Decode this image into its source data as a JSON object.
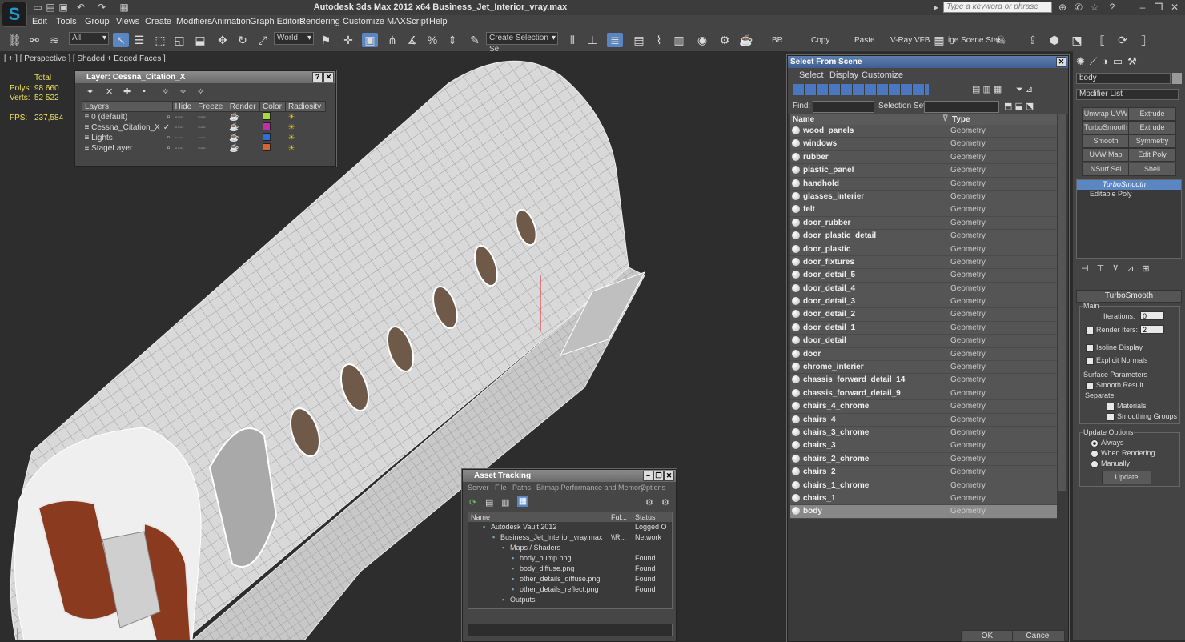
{
  "title": "Autodesk 3ds Max  2012 x64      Business_Jet_Interior_vray.max",
  "search_placeholder": "Type a keyword or phrase",
  "menu": [
    "Edit",
    "Tools",
    "Group",
    "Views",
    "Create",
    "Modifiers",
    "Animation",
    "Graph Editors",
    "Rendering",
    "Customize",
    "MAXScript",
    "Help"
  ],
  "toolbar": {
    "filter": "All",
    "coord_system": "World",
    "selection_set": "Create Selection Se",
    "br": "BR",
    "copy": "Copy",
    "paste": "Paste",
    "vrayvfb": "V-Ray VFB",
    "scene_state": "ige Scene Stat"
  },
  "viewport": {
    "label": "[ + ] [ Perspective ] [ Shaded + Edged Faces ]",
    "stats": {
      "total_label": "Total",
      "polys_label": "Polys:",
      "polys": "98 660",
      "verts_label": "Verts:",
      "verts": "52 522",
      "fps_label": "FPS:",
      "fps": "237,584"
    }
  },
  "layer_window": {
    "title": "Layer: Cessna_Citation_X",
    "columns": [
      "Layers",
      "Hide",
      "Freeze",
      "Render",
      "Color",
      "Radiosity"
    ],
    "rows": [
      {
        "name": "0 (default)",
        "color": "#a6d93a"
      },
      {
        "name": "Cessna_Citation_X",
        "color": "#c02fa6"
      },
      {
        "name": "Lights",
        "color": "#2f6fd9"
      },
      {
        "name": "StageLayer",
        "color": "#d9632f"
      }
    ]
  },
  "select_from_scene": {
    "title": "Select From Scene",
    "menus": [
      "Select",
      "Display",
      "Customize"
    ],
    "find_label": "Find:",
    "selection_set_label": "Selection Set:",
    "col_name": "Name",
    "col_type": "Type",
    "items": [
      {
        "name": "wood_panels",
        "type": "Geometry"
      },
      {
        "name": "windows",
        "type": "Geometry"
      },
      {
        "name": "rubber",
        "type": "Geometry"
      },
      {
        "name": "plastic_panel",
        "type": "Geometry"
      },
      {
        "name": "handhold",
        "type": "Geometry"
      },
      {
        "name": "glasses_interier",
        "type": "Geometry"
      },
      {
        "name": "felt",
        "type": "Geometry"
      },
      {
        "name": "door_rubber",
        "type": "Geometry"
      },
      {
        "name": "door_plastic_detail",
        "type": "Geometry"
      },
      {
        "name": "door_plastic",
        "type": "Geometry"
      },
      {
        "name": "door_fixtures",
        "type": "Geometry"
      },
      {
        "name": "door_detail_5",
        "type": "Geometry"
      },
      {
        "name": "door_detail_4",
        "type": "Geometry"
      },
      {
        "name": "door_detail_3",
        "type": "Geometry"
      },
      {
        "name": "door_detail_2",
        "type": "Geometry"
      },
      {
        "name": "door_detail_1",
        "type": "Geometry"
      },
      {
        "name": "door_detail",
        "type": "Geometry"
      },
      {
        "name": "door",
        "type": "Geometry"
      },
      {
        "name": "chrome_interier",
        "type": "Geometry"
      },
      {
        "name": "chassis_forward_detail_14",
        "type": "Geometry"
      },
      {
        "name": "chassis_forward_detail_9",
        "type": "Geometry"
      },
      {
        "name": "chairs_4_chrome",
        "type": "Geometry"
      },
      {
        "name": "chairs_4",
        "type": "Geometry"
      },
      {
        "name": "chairs_3_chrome",
        "type": "Geometry"
      },
      {
        "name": "chairs_3",
        "type": "Geometry"
      },
      {
        "name": "chairs_2_chrome",
        "type": "Geometry"
      },
      {
        "name": "chairs_2",
        "type": "Geometry"
      },
      {
        "name": "chairs_1_chrome",
        "type": "Geometry"
      },
      {
        "name": "chairs_1",
        "type": "Geometry"
      },
      {
        "name": "body",
        "type": "Geometry",
        "selected": true
      }
    ],
    "ok": "OK",
    "cancel": "Cancel"
  },
  "command_panel": {
    "object_name": "body",
    "modifier_list": "Modifier List",
    "buttons": [
      "Unwrap UVW",
      "Extrude",
      "TurboSmooth",
      "Extrude",
      "Smooth",
      "Symmetry",
      "UVW Map",
      "Edit Poly",
      "NSurf Sel",
      "Shell"
    ],
    "stack": [
      "TurboSmooth",
      "Editable Poly"
    ],
    "rollout": "TurboSmooth",
    "main": "Main",
    "iterations_label": "Iterations:",
    "iterations": "0",
    "render_iters_label": "Render Iters:",
    "render_iters": "2",
    "isoline": "Isoline Display",
    "explicit_normals": "Explicit Normals",
    "surface_params": "Surface Parameters",
    "smooth_result": "Smooth Result",
    "separate": "Separate",
    "materials": "Materials",
    "smoothing_groups": "Smoothing Groups",
    "update_options": "Update Options",
    "always": "Always",
    "when_rendering": "When Rendering",
    "manually": "Manually",
    "update": "Update"
  },
  "asset_tracking": {
    "title": "Asset Tracking",
    "menus": [
      "Server",
      "File",
      "Paths",
      "Bitmap Performance and Memory",
      "Options"
    ],
    "cols": [
      "Name",
      "Ful...",
      "Status"
    ],
    "rows": [
      {
        "name": "Autodesk Vault 2012",
        "full": "",
        "status": "Logged O",
        "indent": 1
      },
      {
        "name": "Business_Jet_Interior_vray.max",
        "full": "\\\\R...",
        "status": "Network",
        "indent": 2
      },
      {
        "name": "Maps / Shaders",
        "full": "",
        "status": "",
        "indent": 3
      },
      {
        "name": "body_bump.png",
        "full": "",
        "status": "Found",
        "indent": 4
      },
      {
        "name": "body_diffuse.png",
        "full": "",
        "status": "Found",
        "indent": 4
      },
      {
        "name": "other_details_diffuse.png",
        "full": "",
        "status": "Found",
        "indent": 4
      },
      {
        "name": "other_details_reflect.png",
        "full": "",
        "status": "Found",
        "indent": 4
      },
      {
        "name": "Outputs",
        "full": "",
        "status": "",
        "indent": 3
      }
    ]
  }
}
